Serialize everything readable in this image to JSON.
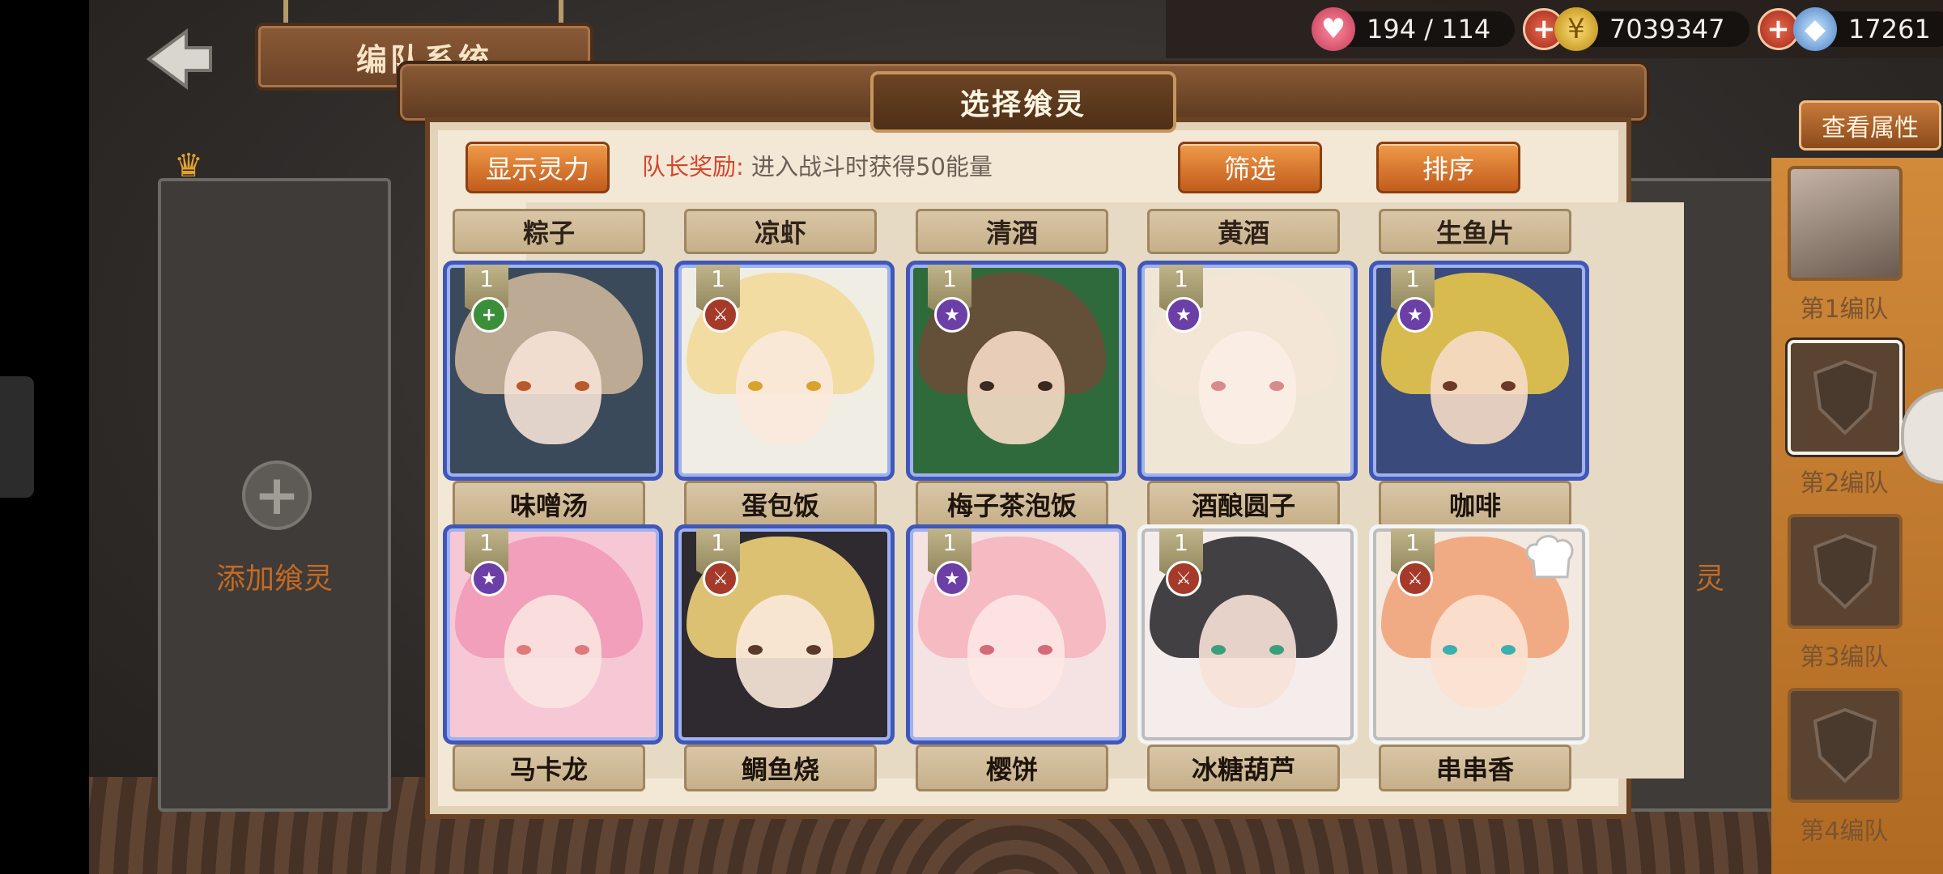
{
  "header": {
    "title": "编队系统"
  },
  "resources": {
    "stamina": "194 / 114",
    "coins": "7039347",
    "gems": "17261"
  },
  "left_slot": {
    "add_label": "添加飨灵",
    "right_fragment": "灵"
  },
  "side_panel": {
    "view_attributes": "查看属性",
    "teams": [
      {
        "label": "第1编队"
      },
      {
        "label": "第2编队"
      },
      {
        "label": "第3编队"
      },
      {
        "label": "第4编队"
      }
    ]
  },
  "modal": {
    "title": "选择飨灵",
    "show_power_button": "显示灵力",
    "leader_bonus_key": "队长奖励:",
    "leader_bonus_text": "进入战斗时获得50能量",
    "filter_button": "筛选",
    "sort_button": "排序"
  },
  "grid": {
    "categories": [
      "粽子",
      "凉虾",
      "清酒",
      "黄酒",
      "生鱼片"
    ],
    "row1": [
      {
        "name": "味噌汤",
        "level": "1",
        "type": "green",
        "glyph": "+",
        "frame": "blue",
        "hair": "#cbb59a",
        "skin": "#f5e2d6",
        "eye": "#b85a2a",
        "bg": "#3b4a5a"
      },
      {
        "name": "蛋包饭",
        "level": "1",
        "type": "red",
        "glyph": "⚔",
        "frame": "blue",
        "hair": "#f2d99a",
        "skin": "#fbe9dc",
        "eye": "#d9a22a",
        "bg": "#f0ede4"
      },
      {
        "name": "梅子茶泡饭",
        "level": "1",
        "type": "purple",
        "glyph": "★",
        "frame": "blue",
        "hair": "#6a4d3a",
        "skin": "#f6dcc8",
        "eye": "#3a2a20",
        "bg": "#2f6a3a"
      },
      {
        "name": "酒酿圆子",
        "level": "1",
        "type": "purple",
        "glyph": "★",
        "frame": "blue",
        "hair": "#f4e6d6",
        "skin": "#fbeee6",
        "eye": "#d98a8a",
        "bg": "#efe6d6"
      },
      {
        "name": "咖啡",
        "level": "1",
        "type": "purple",
        "glyph": "★",
        "frame": "blue",
        "hair": "#e9c84a",
        "skin": "#f6dcc6",
        "eye": "#6a3a2a",
        "bg": "#3a4a7a"
      }
    ],
    "row2": [
      {
        "name": "马卡龙",
        "level": "1",
        "type": "purple",
        "glyph": "★",
        "frame": "blue",
        "hair": "#f29ab8",
        "skin": "#fbe4e2",
        "eye": "#e07a7a",
        "bg": "#f6c8d6"
      },
      {
        "name": "鲷鱼烧",
        "level": "1",
        "type": "red",
        "glyph": "⚔",
        "frame": "blue",
        "hair": "#f1d27a",
        "skin": "#fbe9dc",
        "eye": "#5a3a2a",
        "bg": "#2e2a30"
      },
      {
        "name": "樱饼",
        "level": "1",
        "type": "purple",
        "glyph": "★",
        "frame": "blue",
        "hair": "#f5b6bf",
        "skin": "#fde8e4",
        "eye": "#d46a7a",
        "bg": "#f5e2e2"
      },
      {
        "name": "冰糖葫芦",
        "level": "1",
        "type": "red",
        "glyph": "⚔",
        "frame": "white",
        "hair": "#2f2d30",
        "skin": "#f8e2d8",
        "eye": "#3aa07a",
        "bg": "#f5ecec"
      },
      {
        "name": "串串香",
        "level": "1",
        "type": "red",
        "glyph": "⚔",
        "frame": "white",
        "hair": "#f1a47a",
        "skin": "#fbe2d2",
        "eye": "#3ab0b0",
        "bg": "#f4e9e0",
        "hat": true
      }
    ]
  }
}
